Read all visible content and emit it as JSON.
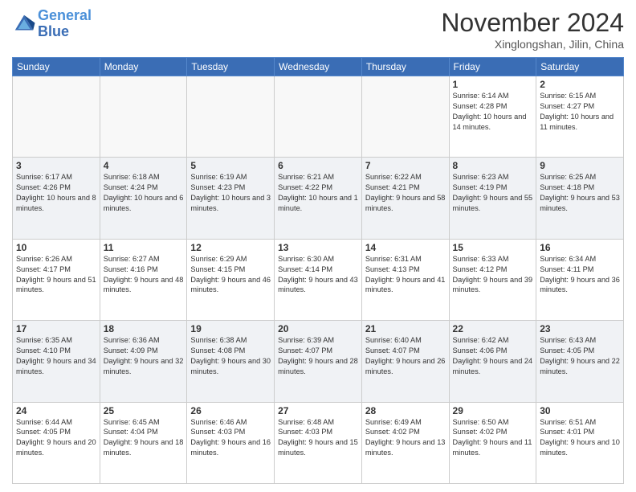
{
  "header": {
    "logo_line1": "General",
    "logo_line2": "Blue",
    "title": "November 2024",
    "location": "Xinglongshan, Jilin, China"
  },
  "days_of_week": [
    "Sunday",
    "Monday",
    "Tuesday",
    "Wednesday",
    "Thursday",
    "Friday",
    "Saturday"
  ],
  "weeks": [
    {
      "shaded": false,
      "days": [
        {
          "num": "",
          "info": ""
        },
        {
          "num": "",
          "info": ""
        },
        {
          "num": "",
          "info": ""
        },
        {
          "num": "",
          "info": ""
        },
        {
          "num": "",
          "info": ""
        },
        {
          "num": "1",
          "info": "Sunrise: 6:14 AM\nSunset: 4:28 PM\nDaylight: 10 hours and 14 minutes."
        },
        {
          "num": "2",
          "info": "Sunrise: 6:15 AM\nSunset: 4:27 PM\nDaylight: 10 hours and 11 minutes."
        }
      ]
    },
    {
      "shaded": true,
      "days": [
        {
          "num": "3",
          "info": "Sunrise: 6:17 AM\nSunset: 4:26 PM\nDaylight: 10 hours and 8 minutes."
        },
        {
          "num": "4",
          "info": "Sunrise: 6:18 AM\nSunset: 4:24 PM\nDaylight: 10 hours and 6 minutes."
        },
        {
          "num": "5",
          "info": "Sunrise: 6:19 AM\nSunset: 4:23 PM\nDaylight: 10 hours and 3 minutes."
        },
        {
          "num": "6",
          "info": "Sunrise: 6:21 AM\nSunset: 4:22 PM\nDaylight: 10 hours and 1 minute."
        },
        {
          "num": "7",
          "info": "Sunrise: 6:22 AM\nSunset: 4:21 PM\nDaylight: 9 hours and 58 minutes."
        },
        {
          "num": "8",
          "info": "Sunrise: 6:23 AM\nSunset: 4:19 PM\nDaylight: 9 hours and 55 minutes."
        },
        {
          "num": "9",
          "info": "Sunrise: 6:25 AM\nSunset: 4:18 PM\nDaylight: 9 hours and 53 minutes."
        }
      ]
    },
    {
      "shaded": false,
      "days": [
        {
          "num": "10",
          "info": "Sunrise: 6:26 AM\nSunset: 4:17 PM\nDaylight: 9 hours and 51 minutes."
        },
        {
          "num": "11",
          "info": "Sunrise: 6:27 AM\nSunset: 4:16 PM\nDaylight: 9 hours and 48 minutes."
        },
        {
          "num": "12",
          "info": "Sunrise: 6:29 AM\nSunset: 4:15 PM\nDaylight: 9 hours and 46 minutes."
        },
        {
          "num": "13",
          "info": "Sunrise: 6:30 AM\nSunset: 4:14 PM\nDaylight: 9 hours and 43 minutes."
        },
        {
          "num": "14",
          "info": "Sunrise: 6:31 AM\nSunset: 4:13 PM\nDaylight: 9 hours and 41 minutes."
        },
        {
          "num": "15",
          "info": "Sunrise: 6:33 AM\nSunset: 4:12 PM\nDaylight: 9 hours and 39 minutes."
        },
        {
          "num": "16",
          "info": "Sunrise: 6:34 AM\nSunset: 4:11 PM\nDaylight: 9 hours and 36 minutes."
        }
      ]
    },
    {
      "shaded": true,
      "days": [
        {
          "num": "17",
          "info": "Sunrise: 6:35 AM\nSunset: 4:10 PM\nDaylight: 9 hours and 34 minutes."
        },
        {
          "num": "18",
          "info": "Sunrise: 6:36 AM\nSunset: 4:09 PM\nDaylight: 9 hours and 32 minutes."
        },
        {
          "num": "19",
          "info": "Sunrise: 6:38 AM\nSunset: 4:08 PM\nDaylight: 9 hours and 30 minutes."
        },
        {
          "num": "20",
          "info": "Sunrise: 6:39 AM\nSunset: 4:07 PM\nDaylight: 9 hours and 28 minutes."
        },
        {
          "num": "21",
          "info": "Sunrise: 6:40 AM\nSunset: 4:07 PM\nDaylight: 9 hours and 26 minutes."
        },
        {
          "num": "22",
          "info": "Sunrise: 6:42 AM\nSunset: 4:06 PM\nDaylight: 9 hours and 24 minutes."
        },
        {
          "num": "23",
          "info": "Sunrise: 6:43 AM\nSunset: 4:05 PM\nDaylight: 9 hours and 22 minutes."
        }
      ]
    },
    {
      "shaded": false,
      "days": [
        {
          "num": "24",
          "info": "Sunrise: 6:44 AM\nSunset: 4:05 PM\nDaylight: 9 hours and 20 minutes."
        },
        {
          "num": "25",
          "info": "Sunrise: 6:45 AM\nSunset: 4:04 PM\nDaylight: 9 hours and 18 minutes."
        },
        {
          "num": "26",
          "info": "Sunrise: 6:46 AM\nSunset: 4:03 PM\nDaylight: 9 hours and 16 minutes."
        },
        {
          "num": "27",
          "info": "Sunrise: 6:48 AM\nSunset: 4:03 PM\nDaylight: 9 hours and 15 minutes."
        },
        {
          "num": "28",
          "info": "Sunrise: 6:49 AM\nSunset: 4:02 PM\nDaylight: 9 hours and 13 minutes."
        },
        {
          "num": "29",
          "info": "Sunrise: 6:50 AM\nSunset: 4:02 PM\nDaylight: 9 hours and 11 minutes."
        },
        {
          "num": "30",
          "info": "Sunrise: 6:51 AM\nSunset: 4:01 PM\nDaylight: 9 hours and 10 minutes."
        }
      ]
    }
  ]
}
